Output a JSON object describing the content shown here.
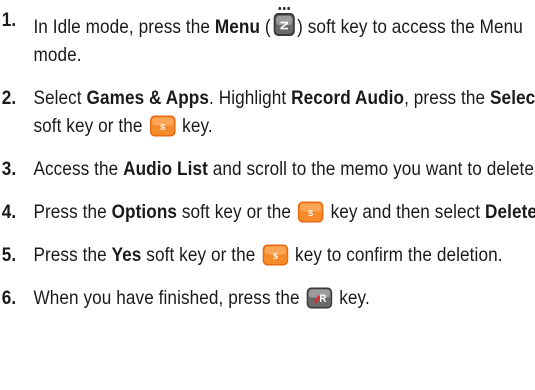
{
  "steps": [
    {
      "num": "1.",
      "parts": [
        {
          "t": "In Idle mode, press the "
        },
        {
          "b": "Menu"
        },
        {
          "t": " ("
        },
        {
          "key": "menu"
        },
        {
          "t": ") soft key to access the Menu mode."
        }
      ]
    },
    {
      "num": "2.",
      "parts": [
        {
          "t": "Select "
        },
        {
          "b": "Games & Apps"
        },
        {
          "t": ". Highlight "
        },
        {
          "b": "Record Audio"
        },
        {
          "t": ", press the "
        },
        {
          "b": "Select"
        },
        {
          "t": " soft key or the "
        },
        {
          "key": "ok"
        },
        {
          "t": " key."
        }
      ]
    },
    {
      "num": "3.",
      "parts": [
        {
          "t": "Access the "
        },
        {
          "b": "Audio List"
        },
        {
          "t": " and scroll to the memo you want to delete."
        }
      ]
    },
    {
      "num": "4.",
      "parts": [
        {
          "t": "Press the "
        },
        {
          "b": "Options"
        },
        {
          "t": " soft key or the "
        },
        {
          "key": "ok"
        },
        {
          "t": " key and then select "
        },
        {
          "b": "Delete."
        }
      ]
    },
    {
      "num": "5.",
      "parts": [
        {
          "t": "Press the "
        },
        {
          "b": "Yes"
        },
        {
          "t": " soft key or the "
        },
        {
          "key": "ok"
        },
        {
          "t": " key to confirm the deletion."
        }
      ]
    },
    {
      "num": "6.",
      "parts": [
        {
          "t": "When you have finished, press the "
        },
        {
          "key": "end"
        },
        {
          "t": " key."
        }
      ]
    }
  ],
  "keys": {
    "menu": {
      "name": "menu-soft-key-icon",
      "glyph": "N"
    },
    "ok": {
      "name": "ok-key-icon",
      "glyph": "s",
      "color": "#f07c18"
    },
    "end": {
      "name": "end-key-icon",
      "glyph": "R",
      "color": "#e0262b"
    }
  }
}
